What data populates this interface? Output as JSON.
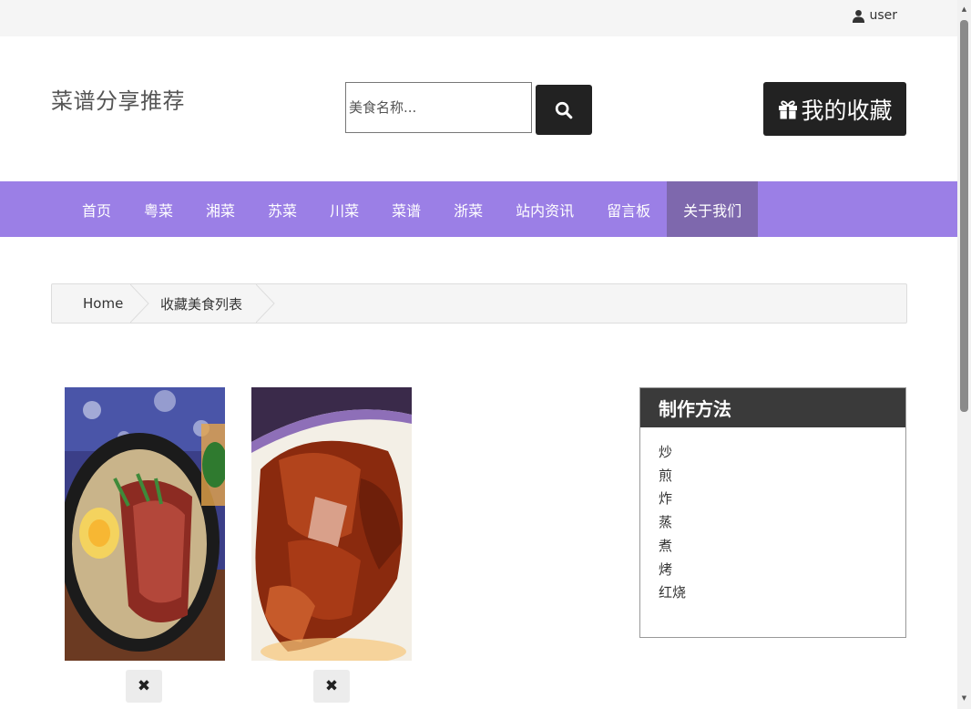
{
  "topbar": {
    "user_label": "user"
  },
  "header": {
    "site_title": "菜谱分享推荐",
    "search_placeholder": "美食名称...",
    "favorites_label": "我的收藏"
  },
  "nav": {
    "items": [
      {
        "label": "首页"
      },
      {
        "label": "粤菜"
      },
      {
        "label": "湘菜"
      },
      {
        "label": "苏菜"
      },
      {
        "label": "川菜"
      },
      {
        "label": "菜谱"
      },
      {
        "label": "浙菜"
      },
      {
        "label": "站内资讯"
      },
      {
        "label": "留言板"
      },
      {
        "label": "关于我们",
        "active": true
      }
    ]
  },
  "breadcrumb": {
    "home": "Home",
    "current": "收藏美食列表"
  },
  "favorites": [
    {
      "image": "clay-pot-rice-with-cured-meat",
      "remove_icon": "✖"
    },
    {
      "image": "roast-duck",
      "remove_icon": "✖"
    }
  ],
  "side_panel": {
    "title": "制作方法",
    "methods": [
      "炒",
      "煎",
      "炸",
      "蒸",
      "煮",
      "烤",
      "红烧"
    ]
  },
  "colors": {
    "nav_bg": "#9b7fe6",
    "nav_active": "#7e68ad",
    "dark_button": "#222222",
    "panel_head": "#3a3a3a"
  }
}
